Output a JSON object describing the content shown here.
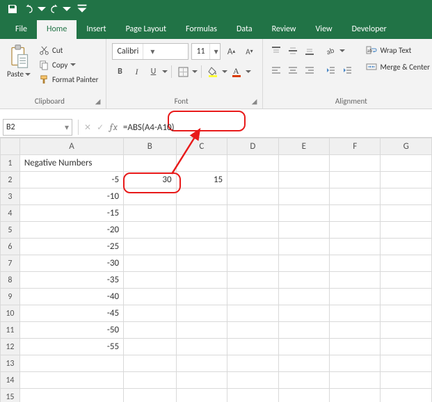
{
  "qat": {
    "save": "save",
    "undo": "undo",
    "redo": "redo"
  },
  "tabs": [
    "File",
    "Home",
    "Insert",
    "Page Layout",
    "Formulas",
    "Data",
    "Review",
    "View",
    "Developer"
  ],
  "active_tab": 1,
  "ribbon": {
    "clipboard": {
      "label": "Clipboard",
      "paste": "Paste",
      "cut": "Cut",
      "copy": "Copy",
      "fmt": "Format Painter"
    },
    "font": {
      "label": "Font",
      "name": "Calibri",
      "size": "11",
      "bold": "B",
      "italic": "I",
      "underline": "U"
    },
    "alignment": {
      "label": "Alignment",
      "wrap": "Wrap Text",
      "merge": "Merge & Center"
    }
  },
  "namebox": "B2",
  "formula": "=ABS(A4-A10)",
  "columns": [
    "A",
    "B",
    "C",
    "D",
    "E",
    "F",
    "G"
  ],
  "rows": [
    "1",
    "2",
    "3",
    "4",
    "5",
    "6",
    "7",
    "8",
    "9",
    "10",
    "11",
    "12",
    "13",
    "14",
    "15"
  ],
  "cells": {
    "A1": "Negative Numbers",
    "A2": "-5",
    "A3": "-10",
    "A4": "-15",
    "A5": "-20",
    "A6": "-25",
    "A7": "-30",
    "A8": "-35",
    "A9": "-40",
    "A10": "-45",
    "A11": "-50",
    "A12": "-55",
    "B2": "30",
    "C2": "15"
  },
  "chart_data": {
    "type": "table",
    "columns": [
      "A",
      "B",
      "C"
    ],
    "rows": [
      {
        "row": 1,
        "A": "Negative Numbers"
      },
      {
        "row": 2,
        "A": -5,
        "B": 30,
        "C": 15
      },
      {
        "row": 3,
        "A": -10
      },
      {
        "row": 4,
        "A": -15
      },
      {
        "row": 5,
        "A": -20
      },
      {
        "row": 6,
        "A": -25
      },
      {
        "row": 7,
        "A": -30
      },
      {
        "row": 8,
        "A": -35
      },
      {
        "row": 9,
        "A": -40
      },
      {
        "row": 10,
        "A": -45
      },
      {
        "row": 11,
        "A": -50
      },
      {
        "row": 12,
        "A": -55
      }
    ],
    "active_cell": "B2",
    "formula_bar": "=ABS(A4-A10)"
  }
}
